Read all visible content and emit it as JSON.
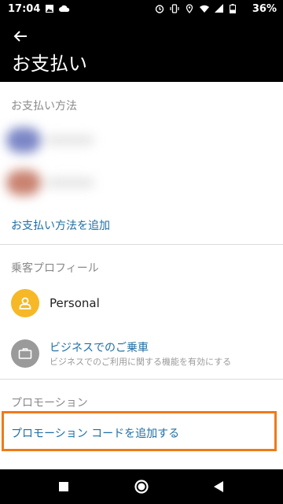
{
  "status_bar": {
    "time": "17:04",
    "battery": "36%",
    "icons": [
      "image-icon",
      "cloud-icon",
      "alarm-icon",
      "vibrate-icon",
      "location-icon",
      "wifi-icon",
      "signal-icon",
      "battery-icon"
    ]
  },
  "header": {
    "title": "お支払い",
    "back_icon": "arrow-left-icon"
  },
  "payment_methods": {
    "section_label": "お支払い方法",
    "items": [
      {
        "icon_color": "#7b86c6",
        "obscured": true
      },
      {
        "icon_color": "#c98270",
        "obscured": true
      }
    ],
    "add_link": "お支払い方法を追加"
  },
  "rider_profiles": {
    "section_label": "乗客プロフィール",
    "personal": {
      "label": "Personal",
      "icon": "person-icon",
      "icon_bg": "#f6b826"
    },
    "business": {
      "label": "ビジネスでのご乗車",
      "sublabel": "ビジネスでのご利用に関する機能を有効にする",
      "icon": "briefcase-icon",
      "icon_bg": "#9a9a9a"
    }
  },
  "promotions": {
    "section_label": "プロモーション",
    "add_link": "プロモーション コードを追加する",
    "highlight_color": "#f07a17"
  },
  "nav_bar": {
    "icons": [
      "recents-square-icon",
      "home-circle-icon",
      "back-triangle-icon"
    ]
  },
  "colors": {
    "header_bg": "#000000",
    "link": "#1f6ea5",
    "muted": "#8a8a8a"
  }
}
